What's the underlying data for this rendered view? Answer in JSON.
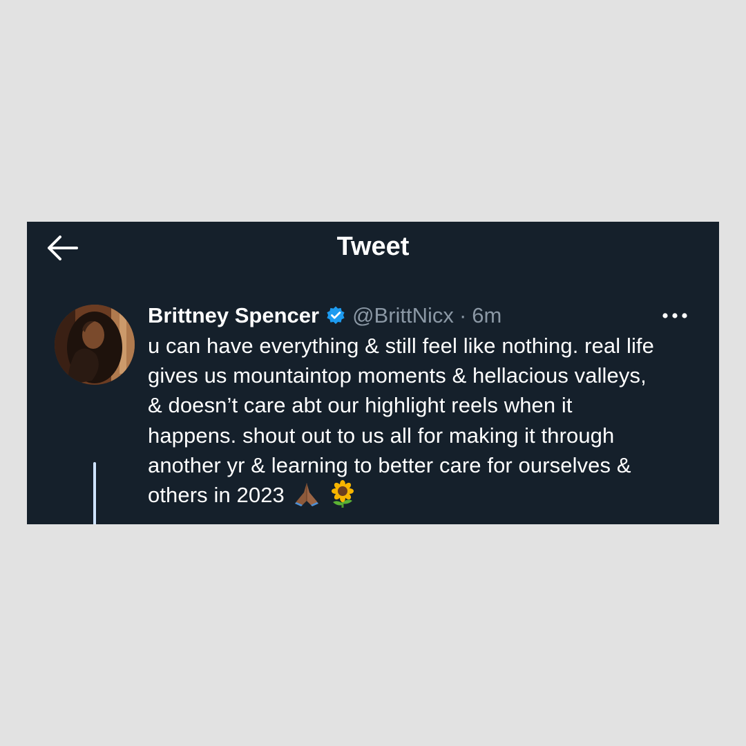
{
  "topbar": {
    "title": "Tweet",
    "back_icon": "back-arrow-icon"
  },
  "tweet": {
    "author": {
      "display_name": "Brittney Spencer",
      "verified": true,
      "handle": "@BrittNicx"
    },
    "separator": "·",
    "time_ago": "6m",
    "more_icon": "more-horizontal-icon",
    "text": "u can have everything & still feel like nothing. real life\ngives us mountaintop moments & hellacious valleys,\n& doesn’t care abt our highlight reels when it\nhappens. shout out to us all for making it through\nanother yr & learning to better care for ourselves &\nothers in 2023",
    "emojis": [
      "praying-hands-icon",
      "sunflower-icon"
    ]
  },
  "colors": {
    "background": "#e2e2e2",
    "card": "#15202b",
    "text_primary": "#ffffff",
    "text_secondary": "#8b98a5",
    "verified_blue": "#1d9bf0",
    "thread_line": "#cfe3ff"
  }
}
